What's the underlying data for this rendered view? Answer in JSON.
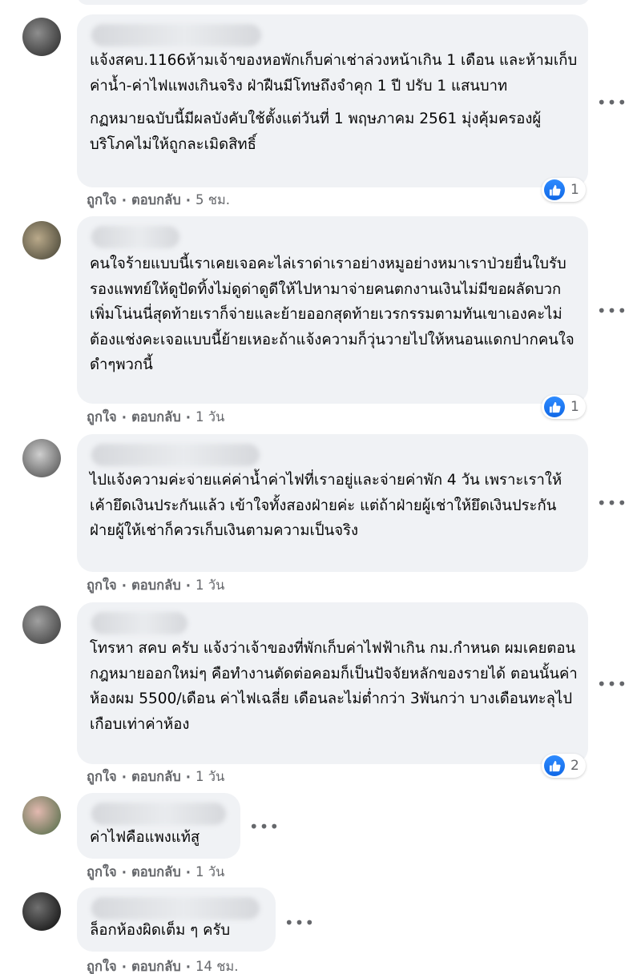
{
  "comments": [
    {
      "paragraphs": [
        "แจ้งสคบ.1166ห้ามเจ้าของหอพักเก็บค่าเช่าล่วงหน้าเกิน 1 เดือน และห้ามเก็บค่าน้ำ-ค่าไฟแพงเกินจริง ฝ่าฝืนมีโทษถึงจำคุก 1 ปี ปรับ 1 แสนบาท",
        "กฏหมายฉบับนี้มีผลบังคับใช้ตั้งแต่วันที่ 1 พฤษภาคม 2561 มุ่งคุ้มครองผู้บริโภคไม่ให้ถูกละเมิดสิทธิ์"
      ],
      "like_label": "ถูกใจ",
      "reply_label": "ตอบกลับ",
      "time": "5 ชม.",
      "reaction_count": "1"
    },
    {
      "paragraphs": [
        "คนใจร้ายแบบนี้เราเคยเจอคะไล่เราด่าเราอย่างหมูอย่างหมาเราป่วยยื่นใบรับรองแพทย์ให้ดูปัดทิ้งไม่ดูด่าดูดีให้ไปหามาจ่ายคนตกงานเงินไม่มีขอผลัดบวกเพิ่มโน่นนี่สุดท้ายเราก็จ่ายและย้ายออกสุดท้ายเวรกรรมตามทันเขาเองคะไม่ต้องแช่งคะเจอแบบนี้ย้ายเหอะถ้าแจ้งความก็วุ่นวายไปให้หนอนแดกปากคนใจดำๆพวกนี้"
      ],
      "like_label": "ถูกใจ",
      "reply_label": "ตอบกลับ",
      "time": "1 วัน",
      "reaction_count": "1"
    },
    {
      "paragraphs": [
        "ไปแจ้งความค่ะจ่ายแค่ค่าน้ำค่าไฟที่เราอยู่และจ่ายค่าพัก 4 วัน เพราะเราให้เค้ายึดเงินประกันแล้ว เข้าใจทั้งสองฝ่ายค่ะ แต่ถ้าฝ่ายผู้เช่าให้ยึดเงินประกันฝ่ายผู้ให้เช่าก็ควรเก็บเงินตามความเป็นจริง"
      ],
      "like_label": "ถูกใจ",
      "reply_label": "ตอบกลับ",
      "time": "1 วัน",
      "reaction_count": ""
    },
    {
      "paragraphs": [
        "โทรหา สคบ ครับ แจ้งว่าเจ้าของที่พักเก็บค่าไฟฟ้าเกิน กม.กำหนด ผมเคยตอนกฎหมายออกใหม่ๆ คือทำงานตัดต่อคอมก็เป็นปัจจัยหลักของรายได้ ตอนนั้นค่าห้องผม 5500/เดือน ค่าไฟเฉลี่ย เดือนละไม่ต่ำกว่า 3พันกว่า บางเดือนทะลุไปเกือบเท่าค่าห้อง"
      ],
      "like_label": "ถูกใจ",
      "reply_label": "ตอบกลับ",
      "time": "1 วัน",
      "reaction_count": "2"
    },
    {
      "paragraphs": [
        "ค่าไฟคือแพงแท้สู"
      ],
      "like_label": "ถูกใจ",
      "reply_label": "ตอบกลับ",
      "time": "1 วัน",
      "reaction_count": ""
    },
    {
      "paragraphs": [
        "ล็อกห้องผิดเต็ม ๆ ครับ"
      ],
      "like_label": "ถูกใจ",
      "reply_label": "ตอบกลับ",
      "time": "14 ชม.",
      "reaction_count": ""
    }
  ],
  "icons": {
    "more": "more-options-icon",
    "like_reaction": "thumbs-up-icon"
  },
  "colors": {
    "bubble": "#f0f2f5",
    "secondary_text": "#65676b",
    "like_blue": "#1877f2"
  }
}
